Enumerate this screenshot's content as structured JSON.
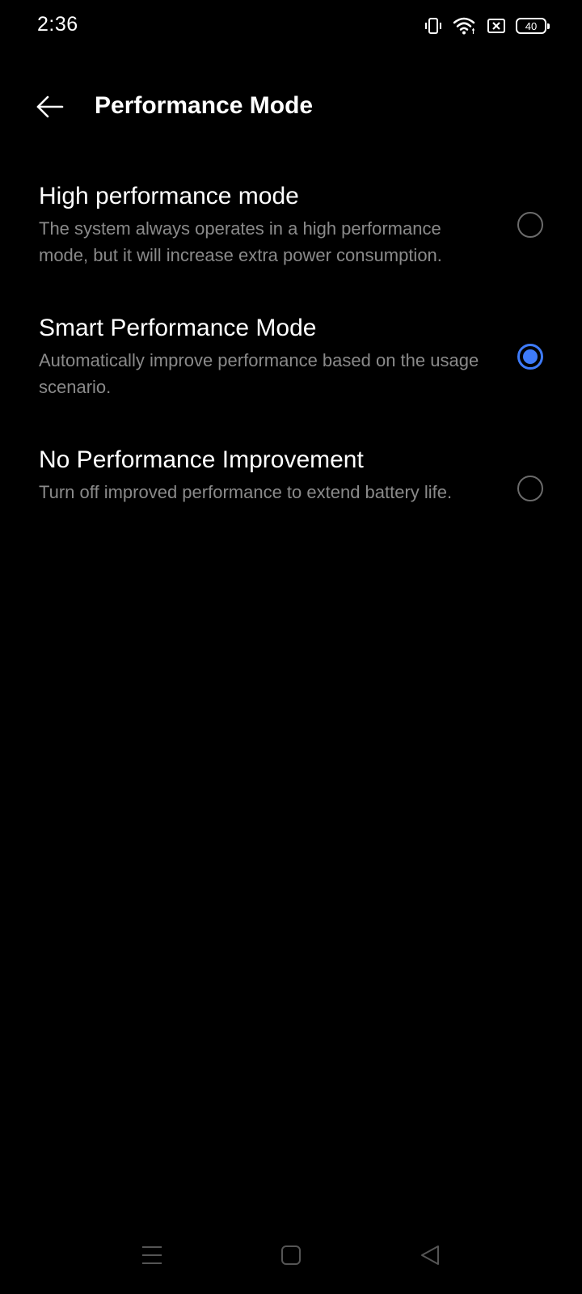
{
  "status_bar": {
    "time": "2:36",
    "battery": "40",
    "icons": [
      "vibrate-icon",
      "wifi-icon",
      "no-sim-icon",
      "battery-icon"
    ]
  },
  "header": {
    "title": "Performance Mode",
    "back_icon": "arrow-left-icon"
  },
  "options": [
    {
      "title": "High performance mode",
      "description": "The system always operates in a high performance mode, but it will increase extra power consumption.",
      "selected": false
    },
    {
      "title": "Smart Performance Mode",
      "description": "Automatically improve performance based on the usage scenario.",
      "selected": true
    },
    {
      "title": "No Performance Improvement",
      "description": "Turn off improved performance to extend battery life.",
      "selected": false
    }
  ],
  "nav_bar": {
    "icons": [
      "menu-icon",
      "home-icon",
      "back-triangle-icon"
    ]
  },
  "colors": {
    "background": "#000000",
    "accent": "#3e7bfa",
    "secondary_text": "#8a8a8a",
    "radio_border": "#6b6b6b"
  }
}
